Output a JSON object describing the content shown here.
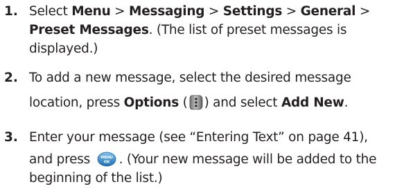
{
  "steps": [
    {
      "num": "1.",
      "lines": [
        {
          "a": "Select ",
          "b1": "Menu",
          "c": " > ",
          "b2": "Messaging",
          "d": " > ",
          "b3": "Settings",
          "e": " > ",
          "b4": "General",
          "f": " >"
        },
        {
          "b1": "Preset Messages",
          "a": ". (The list of preset messages is"
        },
        {
          "a": "displayed.)"
        }
      ]
    },
    {
      "num": "2.",
      "lines": [
        {
          "a": "To add a new message, select the desired message"
        },
        {
          "a": "location, press ",
          "b1": "Options",
          "c": " (",
          "d": ") and select ",
          "b2": "Add New",
          "e": "."
        }
      ]
    },
    {
      "num": "3.",
      "lines": [
        {
          "a": "Enter your message (see “Entering Text” on page 41),"
        },
        {
          "a": "and press ",
          "b": ". (Your new message will be added to the"
        },
        {
          "a": "beginning of the list.)"
        }
      ]
    }
  ],
  "icons": {
    "menu_button_top": "MENU",
    "menu_button_bottom": "OK"
  }
}
